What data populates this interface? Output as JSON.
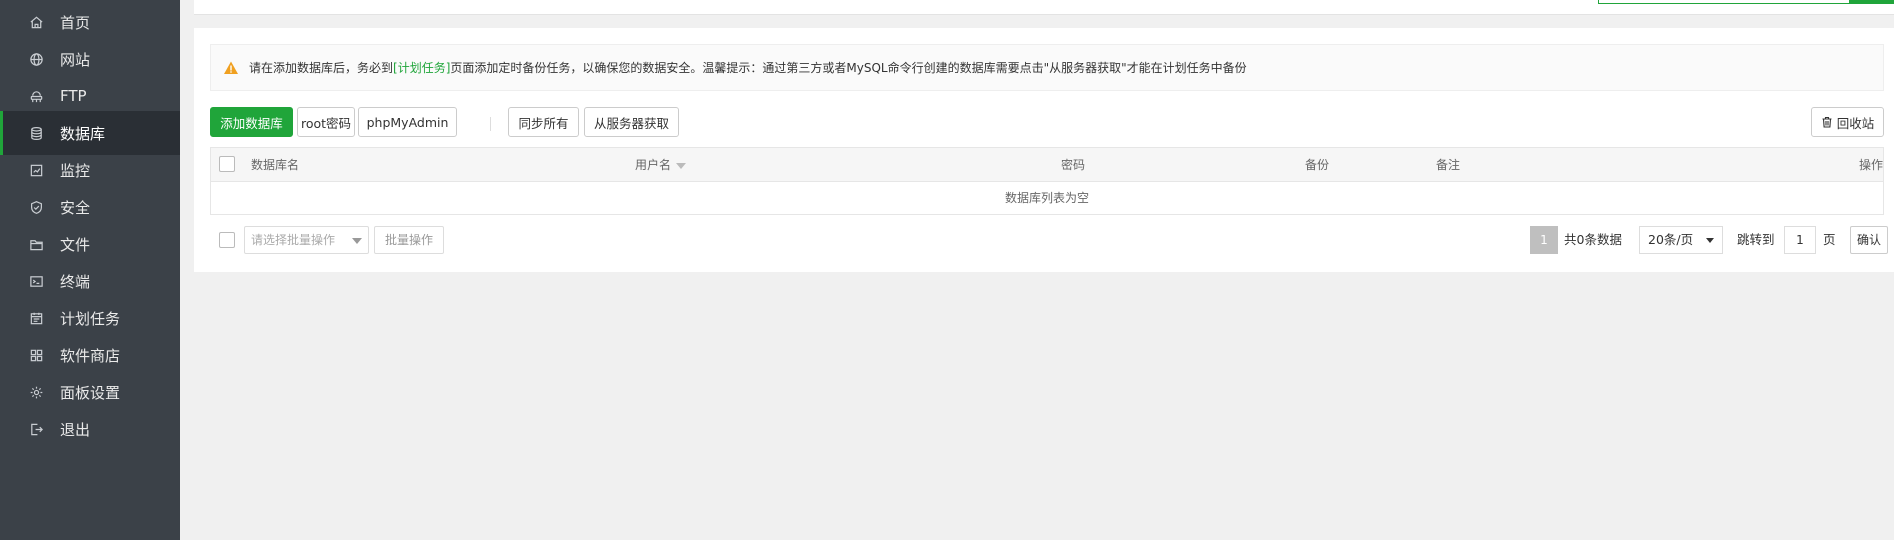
{
  "sidebar": {
    "items": [
      {
        "label": "首页",
        "icon": "home-icon"
      },
      {
        "label": "网站",
        "icon": "globe-icon"
      },
      {
        "label": "FTP",
        "icon": "ftp-icon"
      },
      {
        "label": "数据库",
        "icon": "database-icon",
        "active": true
      },
      {
        "label": "监控",
        "icon": "monitor-icon"
      },
      {
        "label": "安全",
        "icon": "shield-icon"
      },
      {
        "label": "文件",
        "icon": "folder-icon"
      },
      {
        "label": "终端",
        "icon": "terminal-icon"
      },
      {
        "label": "计划任务",
        "icon": "calendar-icon"
      },
      {
        "label": "软件商店",
        "icon": "apps-icon"
      },
      {
        "label": "面板设置",
        "icon": "gear-icon"
      },
      {
        "label": "退出",
        "icon": "logout-icon"
      }
    ]
  },
  "alert": {
    "prefix": "请在添加数据库后，务必到",
    "link": "[计划任务]",
    "suffix": "页面添加定时备份任务，以确保您的数据安全。温馨提示：通过第三方或者MySQL命令行创建的数据库需要点击\"从服务器获取\"才能在计划任务中备份"
  },
  "toolbar": {
    "add_db": "添加数据库",
    "root_pwd": "root密码",
    "phpmyadmin": "phpMyAdmin",
    "sync_all": "同步所有",
    "fetch_server": "从服务器获取",
    "recycle": "回收站"
  },
  "table": {
    "columns": [
      "数据库名",
      "用户名",
      "密码",
      "备份",
      "备注",
      "操作"
    ],
    "empty_text": "数据库列表为空"
  },
  "footer": {
    "batch_placeholder": "请选择批量操作",
    "batch_button": "批量操作",
    "current_page": "1",
    "total_text": "共0条数据",
    "per_page": "20条/页",
    "jump_label": "跳转到",
    "jump_value": "1",
    "page_unit": "页",
    "confirm": "确认"
  },
  "colors": {
    "accent": "#20a53a",
    "sidebar_bg": "#3b4148",
    "warning": "#f0a020"
  }
}
